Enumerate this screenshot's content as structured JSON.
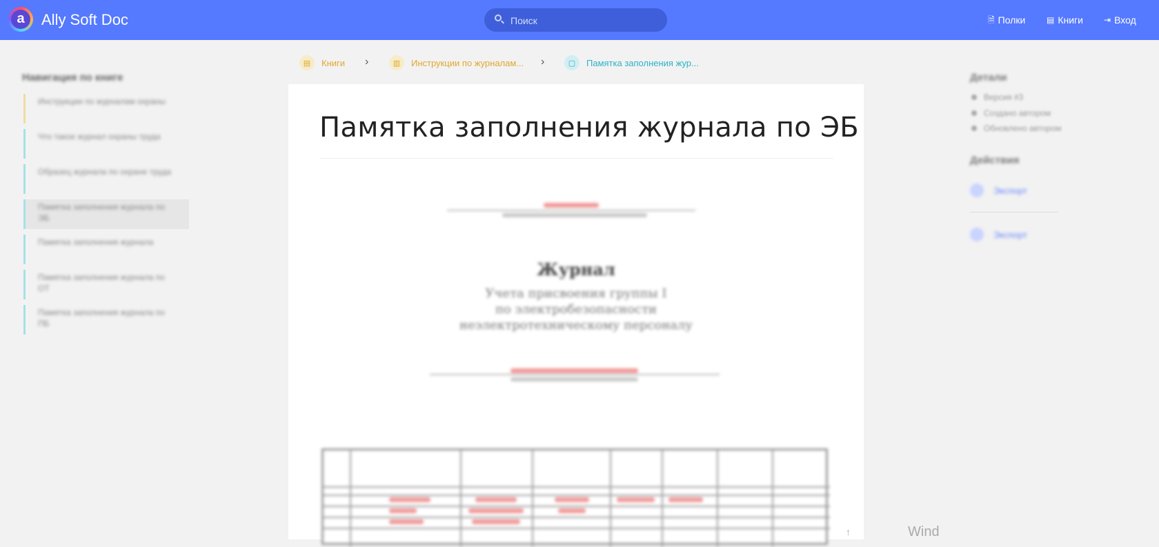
{
  "header": {
    "app_title": "Ally Soft Doc",
    "logo_letter": "a",
    "search_placeholder": "Поиск",
    "nav": [
      {
        "label": "Полки",
        "icon": "shelves-icon"
      },
      {
        "label": "Книги",
        "icon": "books-icon"
      },
      {
        "label": "Вход",
        "icon": "login-icon"
      }
    ],
    "brand_color": "#5579ff"
  },
  "breadcrumb": [
    {
      "label": "Книги",
      "icon": "books-icon"
    },
    {
      "label": "Инструкции по журналам...",
      "icon": "book-icon"
    },
    {
      "label": "Памятка заполнения жур...",
      "icon": "page-icon"
    }
  ],
  "left_nav": {
    "title": "Навигация по книге",
    "items": [
      {
        "label": "Инструкции по журналам охраны",
        "active": false
      },
      {
        "label": "Что такое журнал охраны труда",
        "active": false
      },
      {
        "label": "Образец журнала по охране труда",
        "active": false
      },
      {
        "label": "Памятка заполнения журнала по ЭБ",
        "active": true
      },
      {
        "label": "Памятка заполнения журнала",
        "active": false
      },
      {
        "label": "Памятка заполнения журнала по ОТ",
        "active": false
      },
      {
        "label": "Памятка заполнения журнала по ПБ",
        "active": false
      }
    ]
  },
  "document": {
    "title": "Памятка заполнения журнала по ЭБ",
    "scan_heading": "Журнал",
    "scan_subtitle": [
      "Учета присвоения группы I",
      "по электробезопасности",
      "неэлектротехническому персоналу"
    ]
  },
  "right_panel": {
    "details_title": "Детали",
    "details": [
      "Версия #3",
      "Создано автором",
      "Обновлено автором"
    ],
    "actions_title": "Действия",
    "actions": [
      "Экспорт",
      "Экспорт"
    ]
  },
  "watermark": "Wind"
}
